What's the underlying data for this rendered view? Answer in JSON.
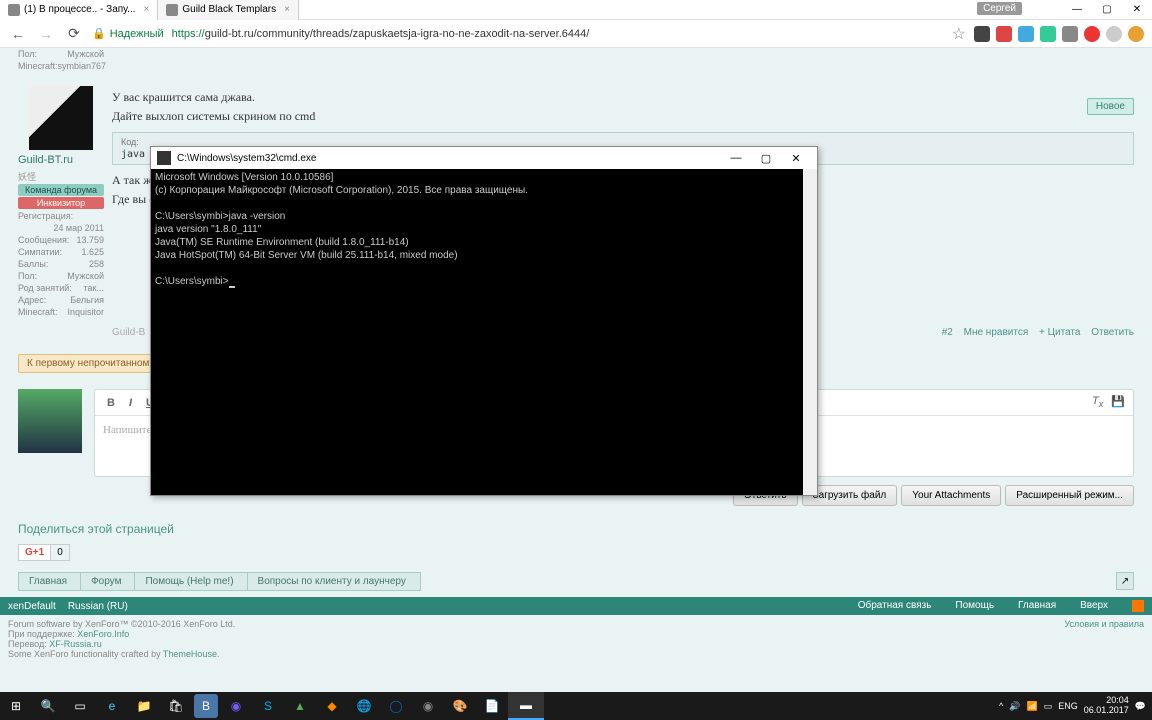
{
  "browser": {
    "tabs": [
      {
        "title": "(1) В процессе.. - Запу...",
        "active": true
      },
      {
        "title": "Guild Black Templars",
        "active": false
      }
    ],
    "user_badge": "Сергей",
    "secure_label": "Надежный",
    "url_prefix": "https://",
    "url": "guild-bt.ru/community/threads/zapuskaetsja-igra-no-ne-zaxodit-na-server.6444/"
  },
  "page": {
    "new_button": "Новое",
    "user1": {
      "field_pol": "Пол:",
      "val_pol": "Мужской",
      "field_mc": "Minecraft:",
      "val_mc": "symbian767"
    },
    "post": {
      "line1": "У вас крашится сама джава.",
      "line2": "Дайте выхлоп системы скрином по cmd",
      "code_hdr": "Код:",
      "code_line": "java -version",
      "line3": "А так же, укажите разрядность вашей системы.",
      "line4": "Где вы скачивали джаву ?"
    },
    "user2": {
      "name": "Guild-BT.ru",
      "sub": "妖怪",
      "badge1": "Команда форума",
      "badge2": "Инквизитор",
      "f_reg": "Регистрация:",
      "v_reg": "24 мар 2011",
      "f_msg": "Сообщения:",
      "v_msg": "13.759",
      "f_sym": "Симпатии:",
      "v_sym": "1.625",
      "f_bal": "Баллы:",
      "v_bal": "258",
      "f_pol": "Пол:",
      "v_pol": "Мужской",
      "f_occ": "Род занятий:",
      "v_occ": "так...",
      "f_adr": "Адрес:",
      "v_adr": "Бельгия",
      "f_mc": "Minecraft:",
      "v_mc": "Inquisitor"
    },
    "postfoot": {
      "sig": "Guild-B",
      "num": "#2",
      "like": "Мне нравится",
      "quote": "+ Цитата",
      "reply": "Ответить"
    },
    "unread_btn": "К первому непрочитанному",
    "reply": {
      "b": "B",
      "i": "I",
      "u": "U",
      "placeholder": "Напишите ответ..."
    },
    "actions": {
      "reply": "Ответить",
      "upload": "Загрузить файл",
      "attach": "Your Attachments",
      "advanced": "Расширенный режим..."
    },
    "share_title": "Поделиться этой страницей",
    "gplus": "G+1",
    "gcount": "0",
    "breadcrumb": [
      "Главная",
      "Форум",
      "Помощь (Help me!)",
      "Вопросы по клиенту и лаунчеру"
    ],
    "footer_bar": {
      "theme": "xenDefault",
      "lang": "Russian (RU)",
      "contact": "Обратная связь",
      "help": "Помощь",
      "home": "Главная",
      "top": "Вверх"
    },
    "footer_txt": {
      "l1a": "Forum software by XenForo™ ",
      "l1b": "©2010-2016 XenForo Ltd.",
      "l2a": "При поддержке: ",
      "l2b": "XenForo.Info",
      "l3a": "Перевод: ",
      "l3b": "XF-Russia.ru",
      "l4a": "Some XenForo functionality crafted by ",
      "l4b": "ThemeHouse",
      "l4c": ".",
      "terms": "Условия и правила"
    }
  },
  "cmd": {
    "title": "C:\\Windows\\system32\\cmd.exe",
    "content": "Microsoft Windows [Version 10.0.10586]\n(c) Корпорация Майкрософт (Microsoft Corporation), 2015. Все права защищены.\n\nC:\\Users\\symbi>java -version\njava version \"1.8.0_111\"\nJava(TM) SE Runtime Environment (build 1.8.0_111-b14)\nJava HotSpot(TM) 64-Bit Server VM (build 25.111-b14, mixed mode)\n\nC:\\Users\\symbi>"
  },
  "taskbar": {
    "lang": "ENG",
    "time": "20:04",
    "date": "06.01.2017"
  }
}
